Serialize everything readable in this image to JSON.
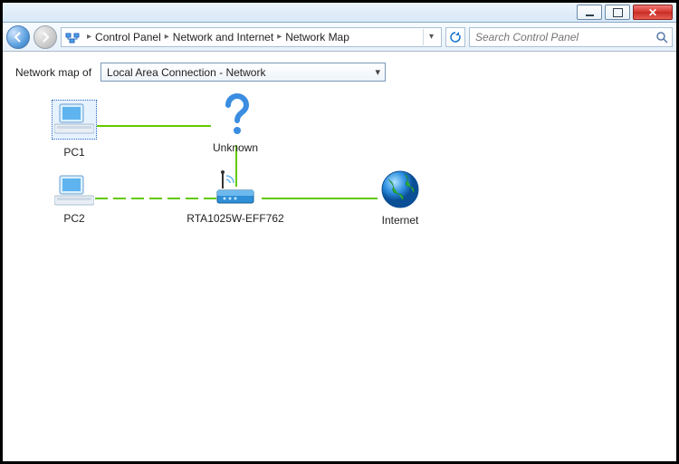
{
  "titlebar": {},
  "nav": {
    "breadcrumb": [
      "Control Panel",
      "Network and Internet",
      "Network Map"
    ],
    "search_placeholder": "Search Control Panel"
  },
  "header": {
    "label": "Network map of",
    "dropdown_value": "Local Area Connection - Network"
  },
  "nodes": {
    "pc1": "PC1",
    "pc2": "PC2",
    "unknown": "Unknown",
    "router": "RTA1025W-EFF762",
    "internet": "Internet"
  }
}
